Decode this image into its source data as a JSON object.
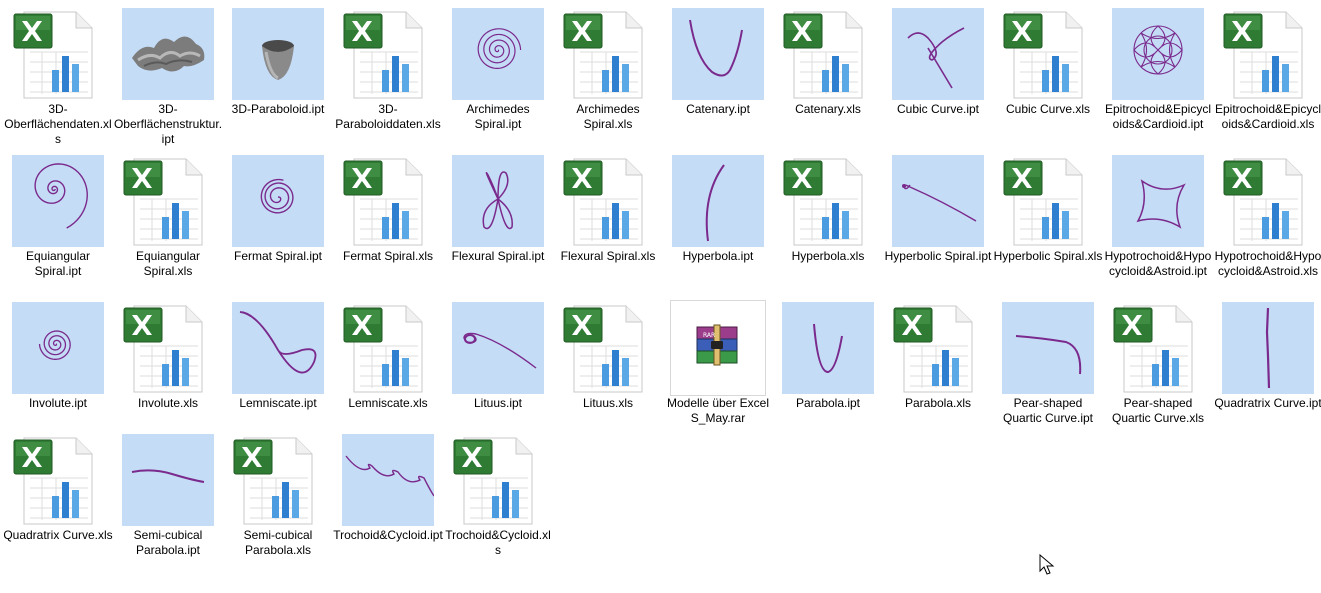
{
  "items": [
    {
      "label": "3D-Oberflächendaten.xls",
      "type": "xls"
    },
    {
      "label": "3D-Oberflächenstruktur.ipt",
      "type": "ipt",
      "icon": "surface-thumbnail-icon"
    },
    {
      "label": "3D-Paraboloid.ipt",
      "type": "ipt",
      "icon": "paraboloid-thumbnail-icon"
    },
    {
      "label": "3D-Paraboloiddaten.xls",
      "type": "xls"
    },
    {
      "label": "Archimedes Spiral.ipt",
      "type": "ipt",
      "icon": "archimedes-spiral-thumbnail-icon"
    },
    {
      "label": "Archimedes Spiral.xls",
      "type": "xls"
    },
    {
      "label": "Catenary.ipt",
      "type": "ipt",
      "icon": "catenary-thumbnail-icon"
    },
    {
      "label": "Catenary.xls",
      "type": "xls"
    },
    {
      "label": "Cubic Curve.ipt",
      "type": "ipt",
      "icon": "cubic-curve-thumbnail-icon"
    },
    {
      "label": "Cubic Curve.xls",
      "type": "xls"
    },
    {
      "label": "Epitrochoid&Epicycloids&Cardioid.ipt",
      "type": "ipt",
      "icon": "epitrochoid-thumbnail-icon"
    },
    {
      "label": "Epitrochoid&Epicycloids&Cardioid.xls",
      "type": "xls"
    },
    {
      "label": "Equiangular Spiral.ipt",
      "type": "ipt",
      "icon": "equiangular-spiral-thumbnail-icon"
    },
    {
      "label": "Equiangular Spiral.xls",
      "type": "xls"
    },
    {
      "label": "Fermat Spiral.ipt",
      "type": "ipt",
      "icon": "fermat-spiral-thumbnail-icon"
    },
    {
      "label": "Fermat Spiral.xls",
      "type": "xls"
    },
    {
      "label": "Flexural Spiral.ipt",
      "type": "ipt",
      "icon": "flexural-spiral-thumbnail-icon"
    },
    {
      "label": "Flexural Spiral.xls",
      "type": "xls"
    },
    {
      "label": "Hyperbola.ipt",
      "type": "ipt",
      "icon": "hyperbola-thumbnail-icon"
    },
    {
      "label": "Hyperbola.xls",
      "type": "xls"
    },
    {
      "label": "Hyperbolic Spiral.ipt",
      "type": "ipt",
      "icon": "hyperbolic-spiral-thumbnail-icon"
    },
    {
      "label": "Hyperbolic Spiral.xls",
      "type": "xls"
    },
    {
      "label": "Hypotrochoid&Hypocycloid&Astroid.ipt",
      "type": "ipt",
      "icon": "astroid-thumbnail-icon"
    },
    {
      "label": "Hypotrochoid&Hypocycloid&Astroid.xls",
      "type": "xls"
    },
    {
      "label": "Involute.ipt",
      "type": "ipt",
      "icon": "involute-thumbnail-icon"
    },
    {
      "label": "Involute.xls",
      "type": "xls"
    },
    {
      "label": "Lemniscate.ipt",
      "type": "ipt",
      "icon": "lemniscate-thumbnail-icon"
    },
    {
      "label": "Lemniscate.xls",
      "type": "xls"
    },
    {
      "label": "Lituus.ipt",
      "type": "ipt",
      "icon": "lituus-thumbnail-icon"
    },
    {
      "label": "Lituus.xls",
      "type": "xls"
    },
    {
      "label": "Modelle über Excel S_May.rar",
      "type": "rar",
      "icon": "winrar-archive-icon"
    },
    {
      "label": "Parabola.ipt",
      "type": "ipt",
      "icon": "parabola-thumbnail-icon"
    },
    {
      "label": "Parabola.xls",
      "type": "xls"
    },
    {
      "label": "Pear-shaped Quartic Curve.ipt",
      "type": "ipt",
      "icon": "pear-quartic-thumbnail-icon"
    },
    {
      "label": "Pear-shaped Quartic Curve.xls",
      "type": "xls"
    },
    {
      "label": "Quadratrix Curve.ipt",
      "type": "ipt",
      "icon": "quadratrix-thumbnail-icon"
    },
    {
      "label": "Quadratrix Curve.xls",
      "type": "xls"
    },
    {
      "label": "Semi-cubical Parabola.ipt",
      "type": "ipt",
      "icon": "semicubical-parabola-thumbnail-icon"
    },
    {
      "label": "Semi-cubical Parabola.xls",
      "type": "xls"
    },
    {
      "label": "Trochoid&Cycloid.ipt",
      "type": "ipt",
      "icon": "trochoid-thumbnail-icon"
    },
    {
      "label": "Trochoid&Cycloid.xls",
      "type": "xls"
    }
  ],
  "colors": {
    "thumbnail_bg": "#c5dcf6",
    "curve": "#7a2a8c",
    "excel_green": "#2f7b34",
    "chart_blue": "#3a8fd6"
  }
}
